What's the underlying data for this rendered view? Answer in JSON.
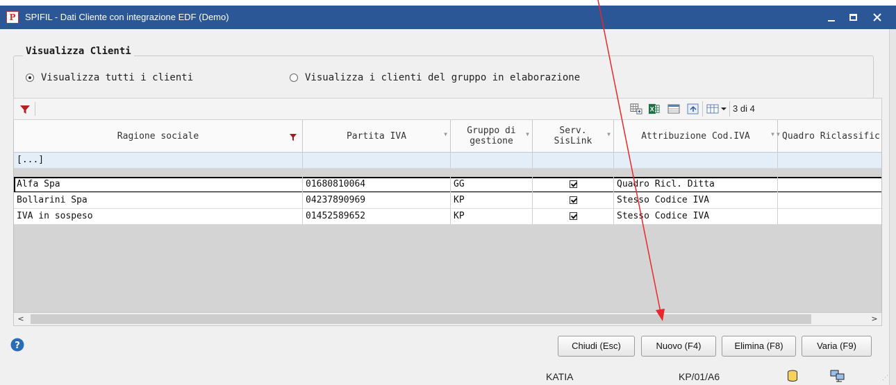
{
  "window": {
    "title": "SPIFIL - Dati Cliente con integrazione EDF (Demo)",
    "icon_letter": "P"
  },
  "group": {
    "title": "Visualizza Clienti",
    "options": [
      {
        "label": "Visualizza tutti i clienti",
        "selected": true
      },
      {
        "label": "Visualizza i clienti del gruppo in elaborazione",
        "selected": false
      }
    ]
  },
  "toolbar": {
    "record_counter": "3 di 4"
  },
  "grid": {
    "columns": [
      {
        "label": "Ragione sociale"
      },
      {
        "label": "Partita IVA"
      },
      {
        "label": "Gruppo di gestione"
      },
      {
        "label": "Serv. SisLink"
      },
      {
        "label": "Attribuzione Cod.IVA"
      },
      {
        "label": "Quadro Riclassific"
      }
    ],
    "filter_row": "[...]",
    "rows": [
      {
        "ragione": "Alfa Spa",
        "piva": "01680810064",
        "gruppo": "GG",
        "sislink": true,
        "attribuzione": "Quadro Ricl. Ditta",
        "quadro": ""
      },
      {
        "ragione": "Bollarini Spa",
        "piva": "04237890969",
        "gruppo": "KP",
        "sislink": true,
        "attribuzione": "Stesso Codice IVA",
        "quadro": ""
      },
      {
        "ragione": "IVA in sospeso",
        "piva": "01452589652",
        "gruppo": "KP",
        "sislink": true,
        "attribuzione": "Stesso Codice IVA",
        "quadro": ""
      }
    ]
  },
  "buttons": {
    "close": "Chiudi (Esc)",
    "new": "Nuovo (F4)",
    "delete": "Elimina (F8)",
    "edit": "Varia (F9)"
  },
  "statusbar": {
    "user": "KATIA",
    "context": "KP/01/A6"
  },
  "colors": {
    "titlebar": "#2b5797",
    "selected_row_border": "#000000",
    "filter_icon": "#b22222",
    "annotation_arrow": "#e8262b"
  }
}
